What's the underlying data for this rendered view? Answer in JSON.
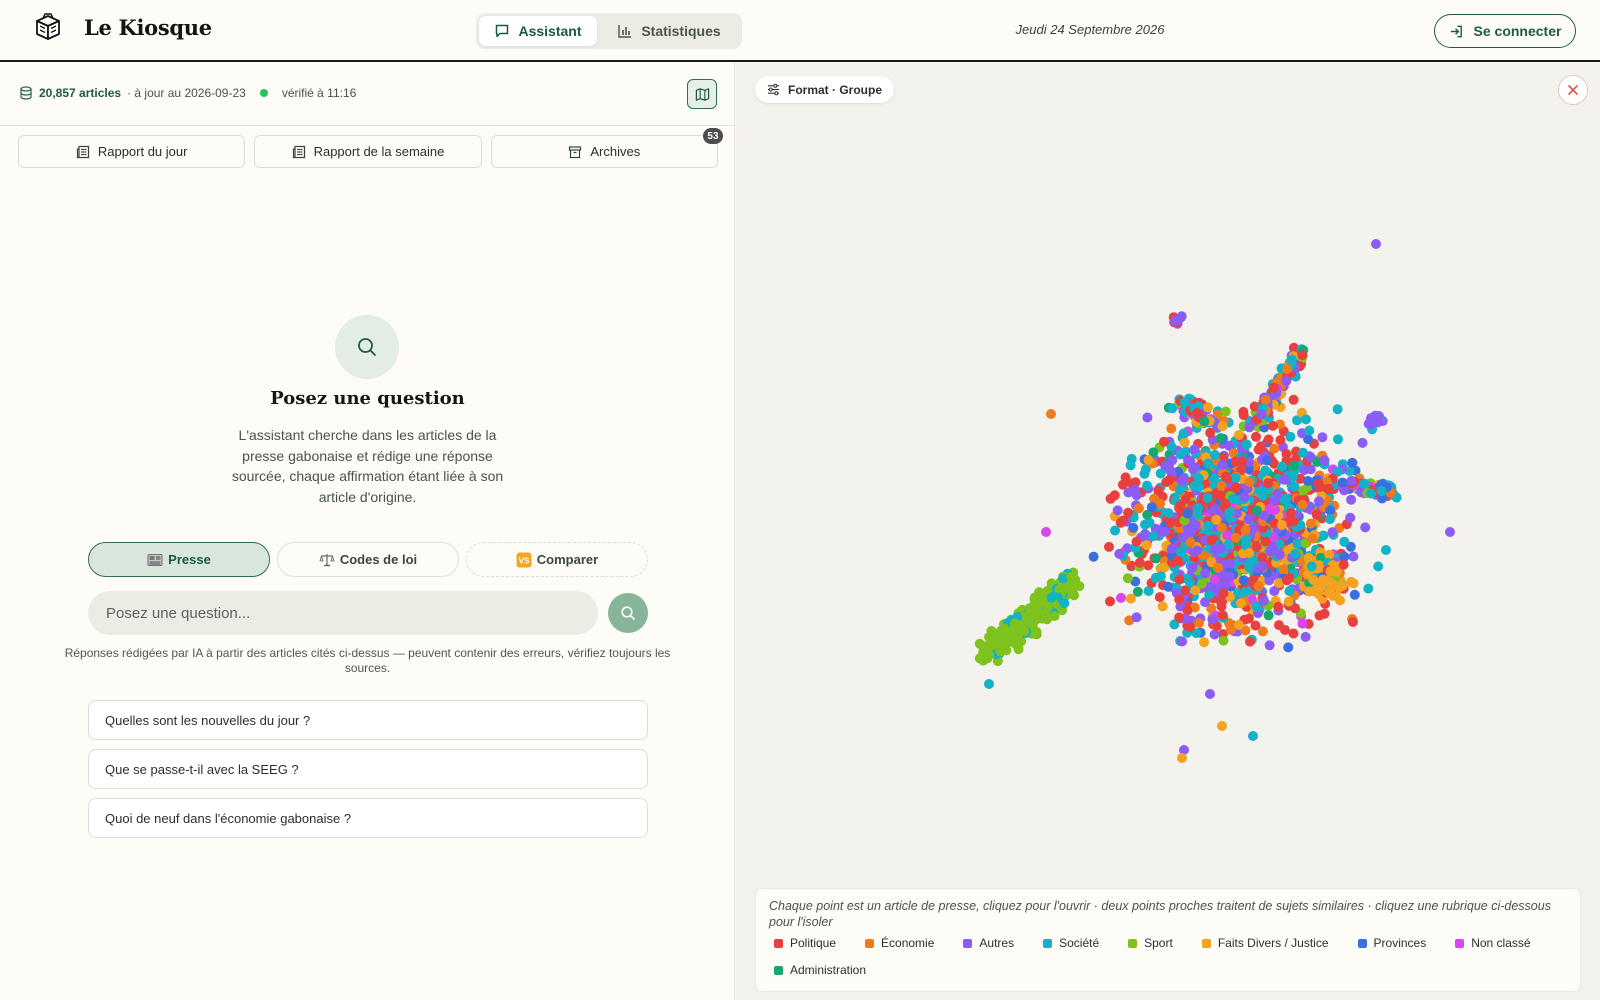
{
  "header": {
    "brand_name": "Le Kiosque",
    "tabs": [
      {
        "label": "Assistant",
        "icon": "chat-bubble-icon",
        "active": true
      },
      {
        "label": "Statistiques",
        "icon": "bar-chart-icon",
        "active": false
      }
    ],
    "date": "Jeudi 24 Septembre 2026",
    "login_label": "Se connecter"
  },
  "status": {
    "count": "20,857 articles",
    "updated": "· à jour au 2026-09-23",
    "verified": "vérifié à 11:16",
    "status_color": "#22c55e"
  },
  "reports": {
    "daily": "Rapport du jour",
    "weekly": "Rapport de la semaine",
    "archives": "Archives",
    "archives_badge": "53"
  },
  "assistant": {
    "title": "Posez une question",
    "description": "L'assistant cherche dans les articles de la presse gabonaise et rédige une réponse sourcée, chaque affirmation étant liée à son article d'origine.",
    "source_tabs": [
      {
        "label": "Presse",
        "icon": "newspaper-icon",
        "active": true
      },
      {
        "label": "Codes de loi",
        "icon": "scales-icon",
        "active": false
      },
      {
        "label": "Comparer",
        "icon": "vs-icon",
        "active": false
      }
    ],
    "input_placeholder": "Posez une question...",
    "disclaimer": "Réponses rédigées par IA à partir des articles cités ci-dessus — peuvent contenir des erreurs, vérifiez toujours les sources.",
    "suggestions": [
      "Quelles sont les nouvelles du jour ?",
      "Que se passe-t-il avec la SEEG ?",
      "Quoi de neuf dans l'économie gabonaise ?"
    ]
  },
  "map": {
    "format_label": "Format · Groupe",
    "note": "Chaque point est un article de presse, cliquez pour l'ouvrir · deux points proches traitent de sujets similaires · cliquez une rubrique ci-dessous pour l'isoler",
    "legend": [
      {
        "label": "Politique",
        "color": "#e8403f"
      },
      {
        "label": "Économie",
        "color": "#f07b1c"
      },
      {
        "label": "Autres",
        "color": "#8b5cf6"
      },
      {
        "label": "Société",
        "color": "#13b2c7"
      },
      {
        "label": "Sport",
        "color": "#7ec21d"
      },
      {
        "label": "Faits Divers / Justice",
        "color": "#f4a21f"
      },
      {
        "label": "Provinces",
        "color": "#3b6fe0"
      },
      {
        "label": "Non classé",
        "color": "#d946ef"
      },
      {
        "label": "Administration",
        "color": "#15a874"
      }
    ]
  },
  "colors": {
    "brand_green": "#1f5b40",
    "accent_soft": "#86b59a",
    "panel_bg": "#f3f2ec"
  }
}
